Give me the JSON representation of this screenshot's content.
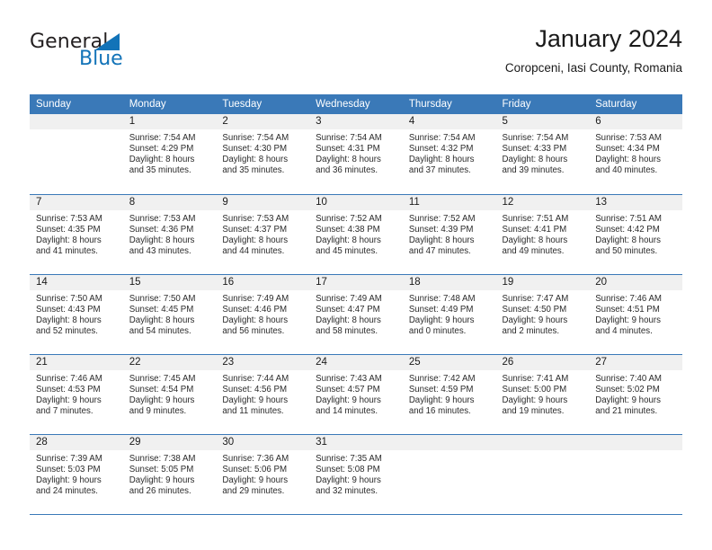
{
  "brand": {
    "name_top": "General",
    "name_bottom": "Blue",
    "accent_color": "#1273b8"
  },
  "header": {
    "title": "January 2024",
    "subtitle": "Coropceni, Iasi County, Romania"
  },
  "theme": {
    "header_row_bg": "#3a79b8",
    "header_row_text": "#ffffff",
    "daynum_bg": "#f0f0f0",
    "grid_line": "#3a79b8"
  },
  "calendar": {
    "weekday_headers": [
      "Sunday",
      "Monday",
      "Tuesday",
      "Wednesday",
      "Thursday",
      "Friday",
      "Saturday"
    ],
    "weeks": [
      [
        {
          "day": "",
          "empty": true,
          "sunrise": "",
          "sunset": "",
          "daylight_line1": "",
          "daylight_line2": ""
        },
        {
          "day": "1",
          "sunrise": "Sunrise: 7:54 AM",
          "sunset": "Sunset: 4:29 PM",
          "daylight_line1": "Daylight: 8 hours",
          "daylight_line2": "and 35 minutes."
        },
        {
          "day": "2",
          "sunrise": "Sunrise: 7:54 AM",
          "sunset": "Sunset: 4:30 PM",
          "daylight_line1": "Daylight: 8 hours",
          "daylight_line2": "and 35 minutes."
        },
        {
          "day": "3",
          "sunrise": "Sunrise: 7:54 AM",
          "sunset": "Sunset: 4:31 PM",
          "daylight_line1": "Daylight: 8 hours",
          "daylight_line2": "and 36 minutes."
        },
        {
          "day": "4",
          "sunrise": "Sunrise: 7:54 AM",
          "sunset": "Sunset: 4:32 PM",
          "daylight_line1": "Daylight: 8 hours",
          "daylight_line2": "and 37 minutes."
        },
        {
          "day": "5",
          "sunrise": "Sunrise: 7:54 AM",
          "sunset": "Sunset: 4:33 PM",
          "daylight_line1": "Daylight: 8 hours",
          "daylight_line2": "and 39 minutes."
        },
        {
          "day": "6",
          "sunrise": "Sunrise: 7:53 AM",
          "sunset": "Sunset: 4:34 PM",
          "daylight_line1": "Daylight: 8 hours",
          "daylight_line2": "and 40 minutes."
        }
      ],
      [
        {
          "day": "7",
          "sunrise": "Sunrise: 7:53 AM",
          "sunset": "Sunset: 4:35 PM",
          "daylight_line1": "Daylight: 8 hours",
          "daylight_line2": "and 41 minutes."
        },
        {
          "day": "8",
          "sunrise": "Sunrise: 7:53 AM",
          "sunset": "Sunset: 4:36 PM",
          "daylight_line1": "Daylight: 8 hours",
          "daylight_line2": "and 43 minutes."
        },
        {
          "day": "9",
          "sunrise": "Sunrise: 7:53 AM",
          "sunset": "Sunset: 4:37 PM",
          "daylight_line1": "Daylight: 8 hours",
          "daylight_line2": "and 44 minutes."
        },
        {
          "day": "10",
          "sunrise": "Sunrise: 7:52 AM",
          "sunset": "Sunset: 4:38 PM",
          "daylight_line1": "Daylight: 8 hours",
          "daylight_line2": "and 45 minutes."
        },
        {
          "day": "11",
          "sunrise": "Sunrise: 7:52 AM",
          "sunset": "Sunset: 4:39 PM",
          "daylight_line1": "Daylight: 8 hours",
          "daylight_line2": "and 47 minutes."
        },
        {
          "day": "12",
          "sunrise": "Sunrise: 7:51 AM",
          "sunset": "Sunset: 4:41 PM",
          "daylight_line1": "Daylight: 8 hours",
          "daylight_line2": "and 49 minutes."
        },
        {
          "day": "13",
          "sunrise": "Sunrise: 7:51 AM",
          "sunset": "Sunset: 4:42 PM",
          "daylight_line1": "Daylight: 8 hours",
          "daylight_line2": "and 50 minutes."
        }
      ],
      [
        {
          "day": "14",
          "sunrise": "Sunrise: 7:50 AM",
          "sunset": "Sunset: 4:43 PM",
          "daylight_line1": "Daylight: 8 hours",
          "daylight_line2": "and 52 minutes."
        },
        {
          "day": "15",
          "sunrise": "Sunrise: 7:50 AM",
          "sunset": "Sunset: 4:45 PM",
          "daylight_line1": "Daylight: 8 hours",
          "daylight_line2": "and 54 minutes."
        },
        {
          "day": "16",
          "sunrise": "Sunrise: 7:49 AM",
          "sunset": "Sunset: 4:46 PM",
          "daylight_line1": "Daylight: 8 hours",
          "daylight_line2": "and 56 minutes."
        },
        {
          "day": "17",
          "sunrise": "Sunrise: 7:49 AM",
          "sunset": "Sunset: 4:47 PM",
          "daylight_line1": "Daylight: 8 hours",
          "daylight_line2": "and 58 minutes."
        },
        {
          "day": "18",
          "sunrise": "Sunrise: 7:48 AM",
          "sunset": "Sunset: 4:49 PM",
          "daylight_line1": "Daylight: 9 hours",
          "daylight_line2": "and 0 minutes."
        },
        {
          "day": "19",
          "sunrise": "Sunrise: 7:47 AM",
          "sunset": "Sunset: 4:50 PM",
          "daylight_line1": "Daylight: 9 hours",
          "daylight_line2": "and 2 minutes."
        },
        {
          "day": "20",
          "sunrise": "Sunrise: 7:46 AM",
          "sunset": "Sunset: 4:51 PM",
          "daylight_line1": "Daylight: 9 hours",
          "daylight_line2": "and 4 minutes."
        }
      ],
      [
        {
          "day": "21",
          "sunrise": "Sunrise: 7:46 AM",
          "sunset": "Sunset: 4:53 PM",
          "daylight_line1": "Daylight: 9 hours",
          "daylight_line2": "and 7 minutes."
        },
        {
          "day": "22",
          "sunrise": "Sunrise: 7:45 AM",
          "sunset": "Sunset: 4:54 PM",
          "daylight_line1": "Daylight: 9 hours",
          "daylight_line2": "and 9 minutes."
        },
        {
          "day": "23",
          "sunrise": "Sunrise: 7:44 AM",
          "sunset": "Sunset: 4:56 PM",
          "daylight_line1": "Daylight: 9 hours",
          "daylight_line2": "and 11 minutes."
        },
        {
          "day": "24",
          "sunrise": "Sunrise: 7:43 AM",
          "sunset": "Sunset: 4:57 PM",
          "daylight_line1": "Daylight: 9 hours",
          "daylight_line2": "and 14 minutes."
        },
        {
          "day": "25",
          "sunrise": "Sunrise: 7:42 AM",
          "sunset": "Sunset: 4:59 PM",
          "daylight_line1": "Daylight: 9 hours",
          "daylight_line2": "and 16 minutes."
        },
        {
          "day": "26",
          "sunrise": "Sunrise: 7:41 AM",
          "sunset": "Sunset: 5:00 PM",
          "daylight_line1": "Daylight: 9 hours",
          "daylight_line2": "and 19 minutes."
        },
        {
          "day": "27",
          "sunrise": "Sunrise: 7:40 AM",
          "sunset": "Sunset: 5:02 PM",
          "daylight_line1": "Daylight: 9 hours",
          "daylight_line2": "and 21 minutes."
        }
      ],
      [
        {
          "day": "28",
          "sunrise": "Sunrise: 7:39 AM",
          "sunset": "Sunset: 5:03 PM",
          "daylight_line1": "Daylight: 9 hours",
          "daylight_line2": "and 24 minutes."
        },
        {
          "day": "29",
          "sunrise": "Sunrise: 7:38 AM",
          "sunset": "Sunset: 5:05 PM",
          "daylight_line1": "Daylight: 9 hours",
          "daylight_line2": "and 26 minutes."
        },
        {
          "day": "30",
          "sunrise": "Sunrise: 7:36 AM",
          "sunset": "Sunset: 5:06 PM",
          "daylight_line1": "Daylight: 9 hours",
          "daylight_line2": "and 29 minutes."
        },
        {
          "day": "31",
          "sunrise": "Sunrise: 7:35 AM",
          "sunset": "Sunset: 5:08 PM",
          "daylight_line1": "Daylight: 9 hours",
          "daylight_line2": "and 32 minutes."
        },
        {
          "day": "",
          "empty": true,
          "sunrise": "",
          "sunset": "",
          "daylight_line1": "",
          "daylight_line2": ""
        },
        {
          "day": "",
          "empty": true,
          "sunrise": "",
          "sunset": "",
          "daylight_line1": "",
          "daylight_line2": ""
        },
        {
          "day": "",
          "empty": true,
          "sunrise": "",
          "sunset": "",
          "daylight_line1": "",
          "daylight_line2": ""
        }
      ]
    ]
  }
}
